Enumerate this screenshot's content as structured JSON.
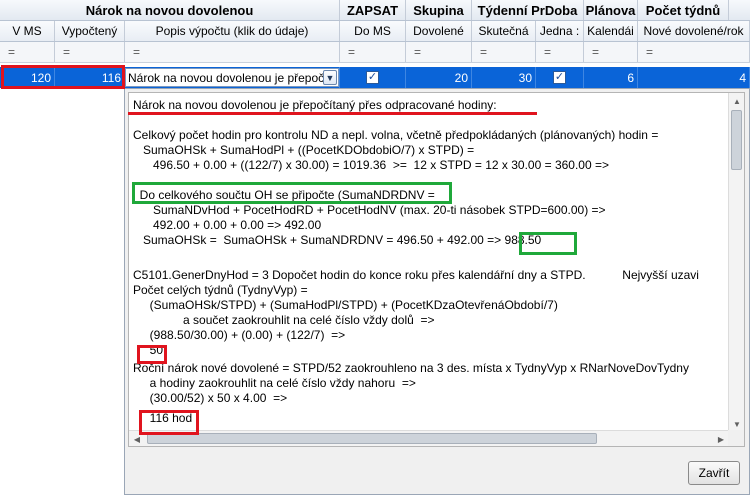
{
  "header_groups": {
    "narok": "Nárok na novou dovolenou",
    "zapsat": "ZAPSAT",
    "skupina": "Skupina",
    "tydenni": "Týdenní PrDoba",
    "planova": "Plánova",
    "pocet": "Počet týdnů"
  },
  "header_cols": [
    "V MS",
    "Vypočtený",
    "Popis výpočtu (klik do údaje)",
    "Do MS",
    "Dovolené",
    "Skutečná",
    "Jedna :",
    "Kalendái",
    "Nové dovolené/rok"
  ],
  "filter_symbol": "=",
  "row": {
    "v_ms": "120",
    "vypocteny": "116",
    "popis": "Nárok na novou dovolenou je přepočí",
    "do_ms_checked": true,
    "dovolene": "20",
    "skutecna": "30",
    "jedna_checked": true,
    "kalendar": "6",
    "nove": "4"
  },
  "popup": {
    "lines": [
      "Nárok na novou dovolenou je přepočítaný přes odpracované hodiny:",
      "",
      "Celkový počet hodin pro kontrolu ND a nepl. volna, včetně předpokládaných (plánovaných) hodin =",
      "   SumaOHSk + SumaHodPl + ((PocetKDObdobiO/7) x STPD) =",
      "      496.50 + 0.00 + ((122/7) x 30.00) = 1019.36  >=  12 x STPD = 12 x 30.00 = 360.00 =>",
      "",
      "  Do celkového součtu OH se připočte (SumaNDRDNV =",
      "      SumaNDvHod + PocetHodRD + PocetHodNV (max. 20-ti násobek STPD=600.00) =>",
      "      492.00 + 0.00 + 0.00 => 492.00",
      "   SumaOHSk =  SumaOHSk + SumaNDRDNV = 496.50 + 492.00 => 988.50",
      "",
      "C5101.GenerDnyHod = 3 Dopočet hodin do konce roku přes kalendářní dny a STPD.           Nejvyšší uzavi",
      "Počet celých týdnů (TydnyVyp) =",
      "     (SumaOHSk/STPD) + (SumaHodPl/STPD) + (PocetKDzaOtevřenáObdobí/7)",
      "               a součet zaokrouhlit na celé číslo vždy dolů  =>",
      "     (988.50/30.00) + (0.00) + (122/7)  =>",
      "     50",
      "Roční nárok nové dovolené = STPD/52 zaokrouhleno na 3 des. místa x TydnyVyp x RNarNoveDovTydny",
      "     a hodiny zaokrouhlit na celé číslo vždy nahoru  =>",
      "     (30.00/52) x 50 x 4.00  =>",
      "     116 hod"
    ],
    "close_label": "Zavřít"
  }
}
